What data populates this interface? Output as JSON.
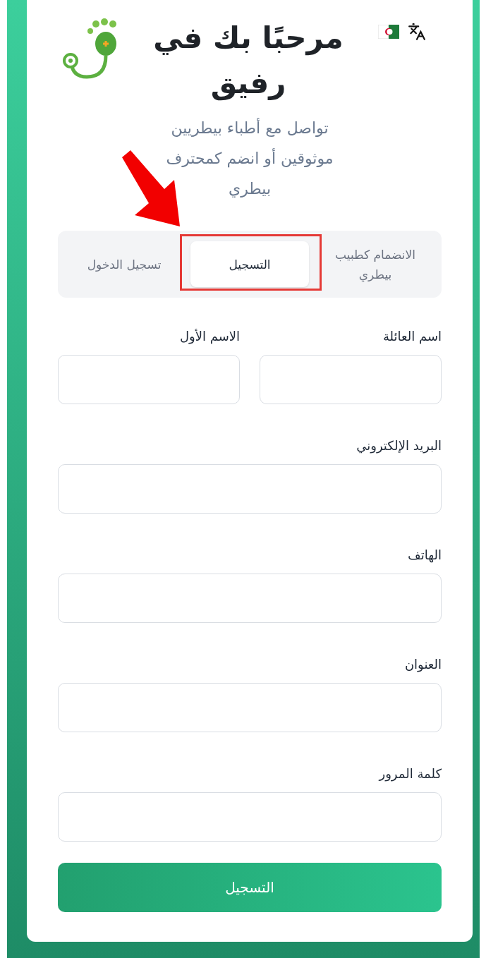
{
  "header": {
    "title": "مرحبًا بك في رفيق",
    "subtitle": "تواصل مع أطباء بيطريين موثوقين أو انضم كمحترف بيطري"
  },
  "tabs": [
    {
      "label": "الانضمام كطبيب بيطري",
      "selected": false
    },
    {
      "label": "التسجيل",
      "selected": true
    },
    {
      "label": "تسجيل الدخول",
      "selected": false
    }
  ],
  "name_fields": [
    {
      "label": "اسم العائلة"
    },
    {
      "label": "الاسم الأول"
    }
  ],
  "fields": [
    {
      "label": "البريد الإلكتروني"
    },
    {
      "label": "الهاتف"
    },
    {
      "label": "العنوان"
    },
    {
      "label": "كلمة المرور"
    }
  ],
  "submit_button": "التسجيل"
}
